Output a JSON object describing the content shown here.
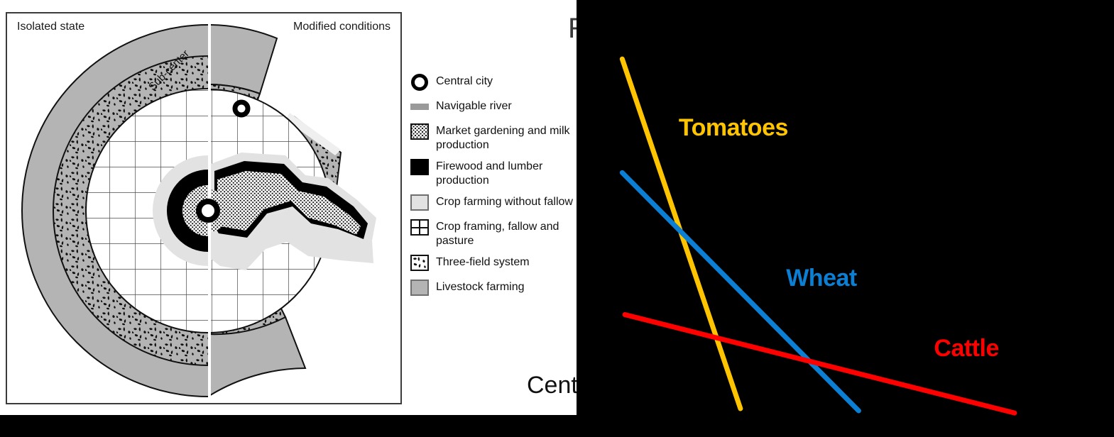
{
  "figure": {
    "panels": {
      "left_caption": "Isolated state",
      "right_caption": "Modified conditions"
    },
    "annotations": {
      "subcenter": "Sub-center"
    },
    "legend": {
      "items": [
        {
          "key": "central-city",
          "label": "Central city",
          "swatch": "ring"
        },
        {
          "key": "navigable-river",
          "label": "Navigable river",
          "swatch": "river",
          "color": "#9a9a9a"
        },
        {
          "key": "market-gardening",
          "label": "Market gardening and milk production",
          "swatch": "dotted"
        },
        {
          "key": "firewood",
          "label": "Firewood and lumber production",
          "swatch": "solid-black",
          "color": "#000000"
        },
        {
          "key": "crop-no-fallow",
          "label": "Crop farming without fallow",
          "swatch": "light-gray",
          "color": "#e2e2e2"
        },
        {
          "key": "crop-fallow",
          "label": "Crop framing, fallow and pasture",
          "swatch": "grid"
        },
        {
          "key": "three-field",
          "label": "Three-field system",
          "swatch": "speckled"
        },
        {
          "key": "livestock",
          "label": "Livestock farming",
          "swatch": "mid-gray",
          "color": "#b4b4b4"
        }
      ]
    }
  },
  "rent_chart": {
    "y_axis_label_visible": "R",
    "x_axis_label_visible": "Centr"
  },
  "chart_data": {
    "type": "line",
    "title": "",
    "xlabel": "Central city  →  Distance",
    "ylabel": "Rent",
    "grid": false,
    "legend_position": "inline-labels",
    "background": "#000000",
    "xlim": [
      0,
      1
    ],
    "ylim": [
      0,
      1
    ],
    "series": [
      {
        "name": "Tomatoes",
        "color": "#FFC400",
        "label_pos": {
          "x": 0.19,
          "y": 0.7
        },
        "points": [
          {
            "x": 0.085,
            "y": 0.865
          },
          {
            "x": 0.305,
            "y": 0.065
          }
        ]
      },
      {
        "name": "Wheat",
        "color": "#0A7FD4",
        "label_pos": {
          "x": 0.39,
          "y": 0.355
        },
        "points": [
          {
            "x": 0.085,
            "y": 0.605
          },
          {
            "x": 0.525,
            "y": 0.06
          }
        ]
      },
      {
        "name": "Cattle",
        "color": "#FF0000",
        "label_pos": {
          "x": 0.665,
          "y": 0.195
        },
        "points": [
          {
            "x": 0.09,
            "y": 0.28
          },
          {
            "x": 0.815,
            "y": 0.055
          }
        ]
      }
    ]
  }
}
